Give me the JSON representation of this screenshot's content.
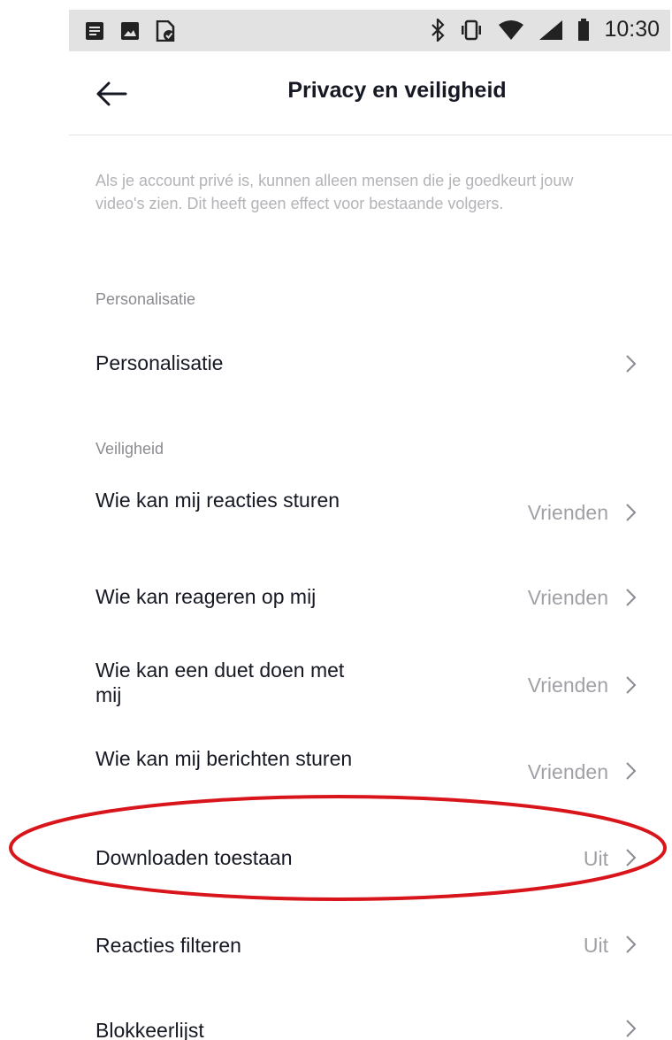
{
  "status_bar": {
    "time": "10:30",
    "left_icons": [
      "notes-icon",
      "image-icon",
      "file-check-icon"
    ],
    "right_icons": [
      "bluetooth-icon",
      "vibrate-icon",
      "wifi-icon",
      "signal-icon",
      "battery-icon"
    ]
  },
  "header": {
    "title": "Privacy en veiligheid"
  },
  "info_text": "Als je account privé is, kunnen alleen mensen die je goedkeurt jouw video's zien. Dit heeft geen effect voor bestaande volgers.",
  "sections": {
    "personalisatie": {
      "header": "Personalisatie",
      "items": [
        {
          "label": "Personalisatie",
          "value": ""
        }
      ]
    },
    "veiligheid": {
      "header": "Veiligheid",
      "items": [
        {
          "label": "Wie kan mij reacties sturen",
          "value": "Vrienden"
        },
        {
          "label": "Wie kan reageren op mij",
          "value": "Vrienden"
        },
        {
          "label": "Wie kan een duet doen met mij",
          "value": "Vrienden"
        },
        {
          "label": "Wie kan mij berichten sturen",
          "value": "Vrienden"
        },
        {
          "label": "Downloaden toestaan",
          "value": "Uit"
        },
        {
          "label": "Reacties filteren",
          "value": "Uit"
        },
        {
          "label": "Blokkeerlijst",
          "value": ""
        }
      ]
    }
  },
  "colors": {
    "highlight": "#d9151c",
    "status_bar_bg": "#e2e2e2",
    "text_primary": "#161823",
    "text_secondary": "#a0a1a6"
  }
}
